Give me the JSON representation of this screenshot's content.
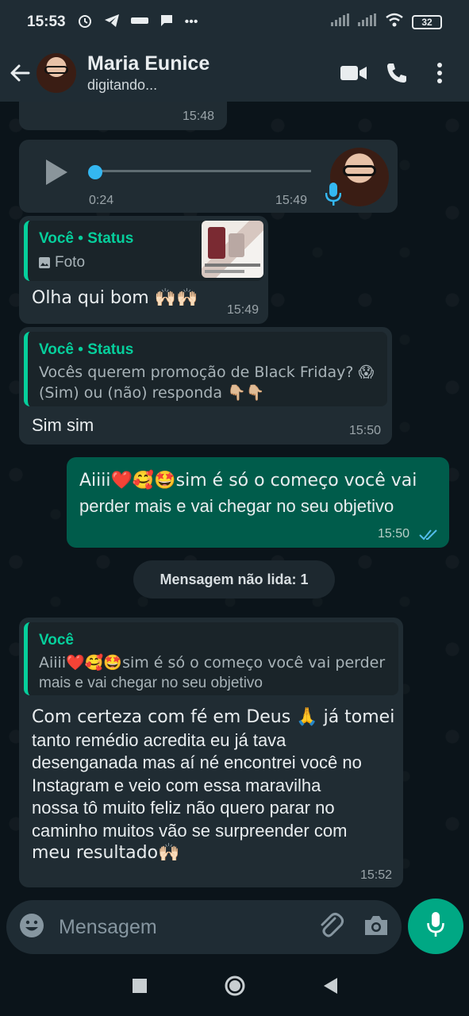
{
  "status_bar": {
    "time": "15:53",
    "app_icons": [
      "alarm-icon",
      "telegram-icon",
      "ifood-icon",
      "chat-icon"
    ],
    "more": "•••",
    "battery": "32"
  },
  "header": {
    "name": "Maria Eunice",
    "status": "digitando..."
  },
  "messages": [
    {
      "type": "text-partial",
      "time": "15:48"
    },
    {
      "type": "audio",
      "duration": "0:24",
      "time": "15:49"
    },
    {
      "type": "reply",
      "quote_author": "Você • Status",
      "quote_text": "Foto",
      "text": "Olha qui bom 🙌🏻🙌🏻",
      "time": "15:49"
    },
    {
      "type": "reply",
      "quote_author": "Você • Status",
      "quote_text_1": "Vocês querem promoção de Black Friday? 😱",
      "quote_text_2": "(Sim) ou (não) responda 👇🏼👇🏼",
      "text": "Sim sim",
      "time": "15:50"
    },
    {
      "type": "outgoing",
      "text_1": "Aiiii❤️🥰🤩sim é só o começo você vai",
      "text_2": "perder mais e vai chegar no seu objetivo",
      "time": "15:50",
      "read": true
    },
    {
      "type": "reply",
      "quote_author": "Você",
      "quote_text_1": "Aiiii❤️🥰🤩sim é só o começo você vai perder",
      "quote_text_2": "mais e vai chegar no seu objetivo",
      "lines": [
        "Com certeza com fé em Deus 🙏 já tomei",
        "tanto remédio acredita eu já tava",
        "desenganada mas aí né encontrei você no",
        "Instagram e veio com essa maravilha",
        "nossa tô muito feliz não quero parar no",
        "caminho muitos vão se surpreender com",
        "meu resultado🙌🏻"
      ],
      "time": "15:52"
    }
  ],
  "unread_label": "Mensagem não lida: 1",
  "input": {
    "placeholder": "Mensagem"
  },
  "colors": {
    "accent": "#00a884",
    "outgoing": "#005c4b",
    "incoming": "#202c33",
    "quote_bar": "#06cf9c",
    "read_ticks": "#53bdeb"
  }
}
